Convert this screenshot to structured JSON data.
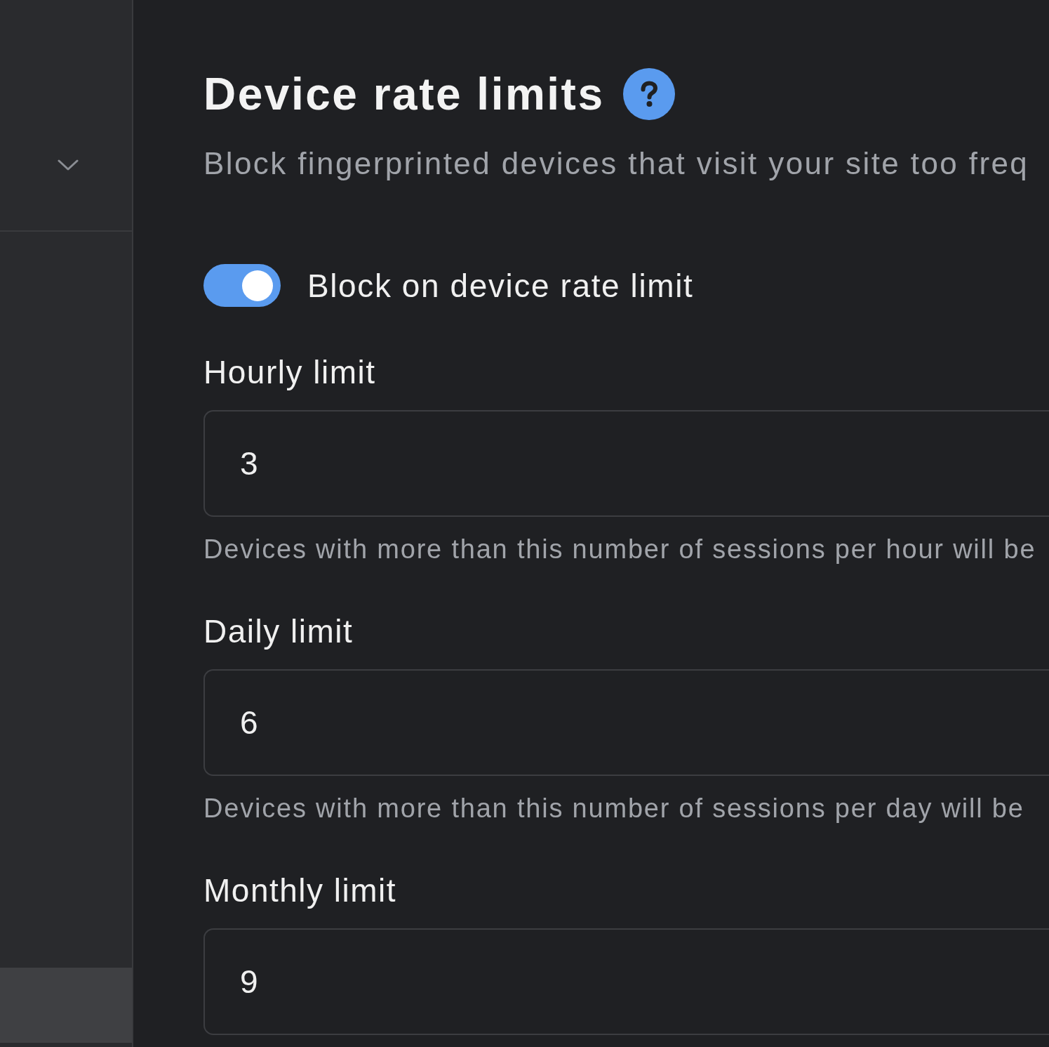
{
  "sidebar": {
    "items": [
      {
        "selected": true
      }
    ]
  },
  "header": {
    "title": "Device rate limits",
    "subtitle": "Block fingerprinted devices that visit your site too freq"
  },
  "toggle": {
    "label": "Block on device rate limit",
    "on": true
  },
  "fields": [
    {
      "label": "Hourly limit",
      "value": "3",
      "help": "Devices with more than this number of sessions per hour will be"
    },
    {
      "label": "Daily limit",
      "value": "6",
      "help": "Devices with more than this number of sessions per day will be"
    },
    {
      "label": "Monthly limit",
      "value": "9"
    }
  ]
}
